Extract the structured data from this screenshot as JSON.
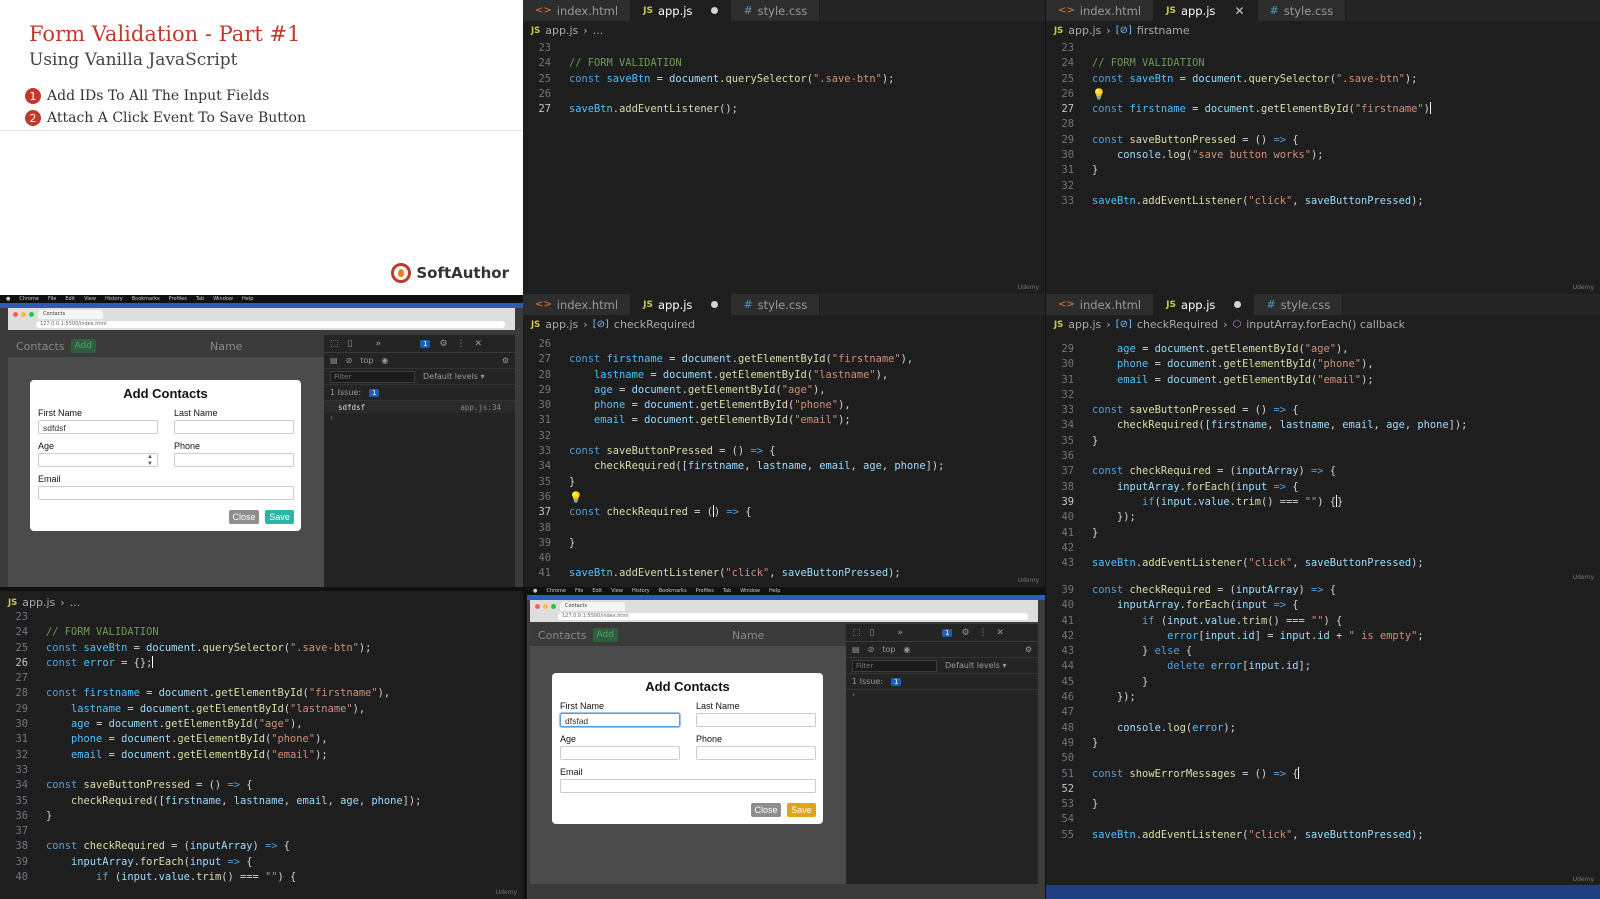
{
  "slide": {
    "title": "Form Validation - Part #1",
    "subtitle": "Using Vanilla JavaScript",
    "steps": [
      {
        "num": "1",
        "text": "Add IDs To All The Input Fields"
      },
      {
        "num": "2",
        "text": "Attach A Click Event To Save Button"
      }
    ],
    "brand": "SoftAuthor"
  },
  "editor_tabs": {
    "html": "index.html",
    "js": "app.js",
    "css": "style.css"
  },
  "breadcrumbs": {
    "e1": [
      "app.js",
      "..."
    ],
    "e2": [
      "app.js",
      "firstname"
    ],
    "e3": [
      "app.js",
      "checkRequired"
    ],
    "e4": [
      "app.js",
      "checkRequired",
      "inputArray.forEach() callback"
    ],
    "e5": [
      "app.js",
      "..."
    ]
  },
  "watermark": "Udemy",
  "browser": {
    "nav_contacts": "Contacts",
    "nav_add": "Add",
    "nav_name": "Name",
    "url": "127.0.0.1:5500/index.html",
    "tab_label": "Contacts",
    "modal": {
      "title": "Add Contacts",
      "first_name_label": "First Name",
      "last_name_label": "Last Name",
      "age_label": "Age",
      "phone_label": "Phone",
      "email_label": "Email",
      "close_label": "Close",
      "save_label": "Save"
    },
    "first_name_value_1": "sdfdsf",
    "first_name_value_2": "dfsfad",
    "devtools": {
      "context": "top",
      "filter_placeholder": "Filter",
      "levels": "Default levels ▾",
      "issues_label": "1 Issue:",
      "issues_count": "1",
      "badge_count": "1",
      "log_text": "sdfdsf",
      "log_source": "app.js:34"
    },
    "accent_save_1": "#2bb5a5",
    "accent_save_2": "#e3a21a"
  },
  "colors": {
    "slide_title": "#c0392b",
    "editor_bg": "#1e1e1e"
  }
}
